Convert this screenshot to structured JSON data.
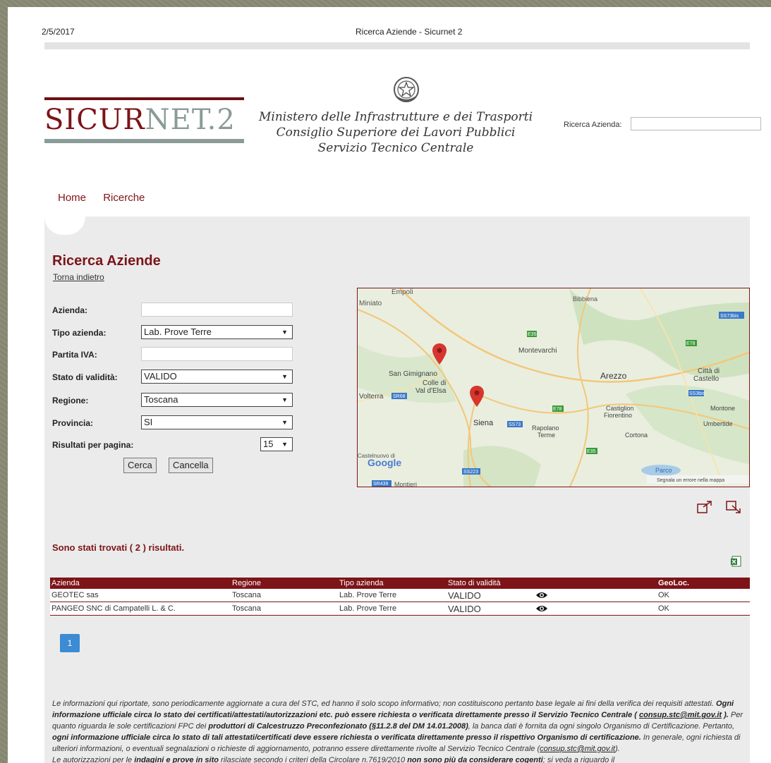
{
  "print_header": {
    "date": "2/5/2017",
    "title": "Ricerca Aziende - Sicurnet 2"
  },
  "logo": {
    "part1": "SICUR",
    "part2": "NET.2"
  },
  "ministry": {
    "line1": "Ministero delle Infrastrutture e dei Trasporti",
    "line2": "Consiglio Superiore dei Lavori Pubblici",
    "line3": "Servizio Tecnico Centrale"
  },
  "header_search": {
    "label": "Ricerca Azienda:"
  },
  "nav": {
    "home": "Home",
    "ricerche": "Ricerche"
  },
  "page": {
    "title": "Ricerca Aziende",
    "back": "Torna indietro"
  },
  "form": {
    "azienda_label": "Azienda:",
    "tipo_label": "Tipo azienda:",
    "tipo_value": "Lab. Prove Terre",
    "piva_label": "Partita IVA:",
    "stato_label": "Stato di validità:",
    "stato_value": "VALIDO",
    "regione_label": "Regione:",
    "regione_value": "Toscana",
    "provincia_label": "Provincia:",
    "provincia_value": "SI",
    "risultati_label": "Risultati per pagina:",
    "risultati_value": "15",
    "cerca": "Cerca",
    "cancella": "Cancella"
  },
  "map": {
    "labels": {
      "empoli": "Empoli",
      "miniato": "Miniato",
      "bibbiena": "Bibbiena",
      "s573bis": "SS73bis",
      "e35_top": "E35",
      "e78_top": "E78",
      "montevarchi": "Montevarchi",
      "sangimignano": "San Gimignano",
      "colle1": "Colle di",
      "colle2": "Val d'Elsa",
      "arezzo": "Arezzo",
      "citta1": "Città di",
      "citta2": "Castello",
      "ss3bis": "SS3bis",
      "volterra": "Volterra",
      "sr68": "SR68",
      "siena": "Siena",
      "ss73": "SS73",
      "e78_mid": "E78",
      "castiglion1": "Castiglion",
      "castiglion2": "Fiorentino",
      "montone": "Montone",
      "umbertide": "Umbertide",
      "rapolano1": "Rapolano",
      "rapolano2": "Terme",
      "cortona": "Cortona",
      "castelnuovo1": "Castelnuovo di",
      "google": "Google",
      "e35_bot": "E35",
      "ss223": "SS223",
      "sr439": "SR439",
      "montieri": "Montieri",
      "parco": "Parco",
      "report": "Segnala un errore nella mappa"
    }
  },
  "results": {
    "summary": "Sono stati trovati ( 2 ) risultati."
  },
  "table": {
    "headers": [
      "Azienda",
      "Regione",
      "Tipo azienda",
      "Stato di validità",
      "GeoLoc."
    ],
    "rows": [
      {
        "azienda": "GEOTEC sas",
        "regione": "Toscana",
        "tipo": "Lab. Prove Terre",
        "stato": "VALIDO",
        "geoloc": "OK"
      },
      {
        "azienda": "PANGEO SNC di Campatelli L. & C.",
        "regione": "Toscana",
        "tipo": "Lab. Prove Terre",
        "stato": "VALIDO",
        "geoloc": "OK"
      }
    ]
  },
  "pagination": {
    "current": "1"
  },
  "footer": {
    "p1a": "Le informazioni qui riportate, sono periodicamente aggiornate a cura del STC, ed hanno il solo scopo informativo; non costituiscono pertanto base legale ai fini della verifica dei requisiti attestati. ",
    "p1b": "Ogni informazione ufficiale circa lo stato dei certificati/attestati/autorizzazioni etc. può essere richiesta o verificata direttamente presso il Servizio Tecnico Centrale ( ",
    "email1": "consup.stc@mit.gov.it",
    "p1c": " ).",
    "p1d": " Per quanto riguarda le sole certificazioni FPC dei ",
    "p1e": "produttori di Calcestruzzo Preconfezionato (§11.2.8 del DM 14.01.2008)",
    "p1f": ", la banca dati è fornita da ogni singolo Organismo di Certificazione. Pertanto, ",
    "p1g": "ogni informazione ufficiale circa lo stato di tali attestati/certificati deve essere richiesta o verificata direttamente presso il rispettivo Organismo di certificazione.",
    "p1h": " In generale, ogni richiesta di ulteriori informazioni, o eventuali segnalazioni o richieste di aggiornamento, potranno essere direttamente rivolte al Servizio Tecnico Centrale (",
    "email2": "consup.stc@mit.gov.it",
    "p1i": ").",
    "p2a": "Le autorizzazioni per le ",
    "p2b": "indagini e prove in sito",
    "p2c": " rilasciate secondo i criteri della Circolare n.7619/2010 ",
    "p2d": "non sono più da considerare cogenti",
    "p2e": "; si veda a riguardo il"
  },
  "colors": {
    "brand": "#7d1418",
    "accent_gray": "#8a9b98",
    "page_button": "#3c8bd3",
    "panel_bg": "#ebebeb"
  }
}
